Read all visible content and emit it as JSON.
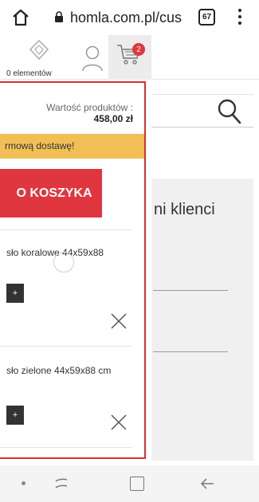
{
  "browser": {
    "url": "homla.com.pl/cus",
    "tab_count": "67"
  },
  "header": {
    "compare_count_label": "0 elementów",
    "cart_badge": "2"
  },
  "page": {
    "heading_fragment": "ni klienci"
  },
  "cart": {
    "total_label": "Wartość produktów :",
    "total_value": "458,00 zł",
    "shipping_text": "rmową dostawę!",
    "checkout_label": "O KOSZYKA",
    "items": [
      {
        "name": "sło koralowe 44x59x88",
        "plus_label": "+"
      },
      {
        "name": "sło zielone 44x59x88 cm",
        "plus_label": "+"
      }
    ]
  },
  "colors": {
    "accent_red": "#e0363f",
    "shipping_yellow": "#f1bf55"
  }
}
